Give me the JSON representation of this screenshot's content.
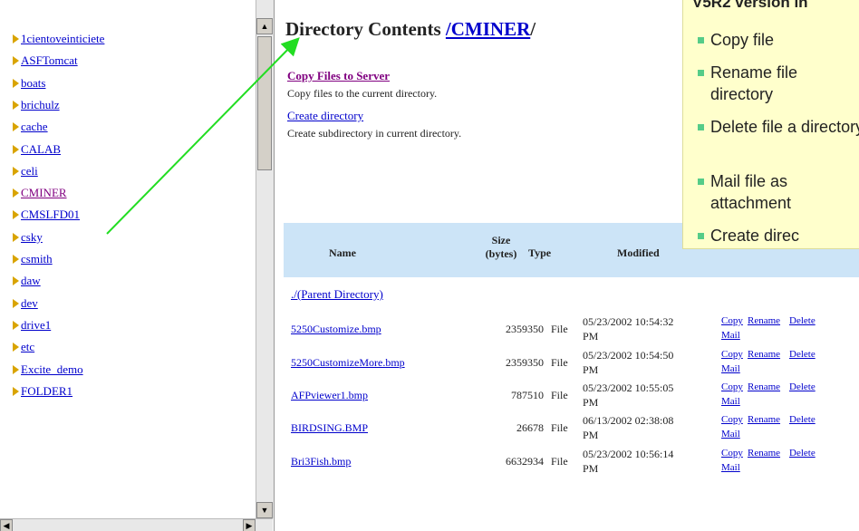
{
  "tree": {
    "items": [
      {
        "label": "1cientoveinticiete",
        "visited": false
      },
      {
        "label": "ASFTomcat",
        "visited": false
      },
      {
        "label": "boats",
        "visited": false
      },
      {
        "label": "brichulz",
        "visited": false
      },
      {
        "label": "cache",
        "visited": false
      },
      {
        "label": "CALAB",
        "visited": false
      },
      {
        "label": "celi",
        "visited": false
      },
      {
        "label": "CMINER",
        "visited": true
      },
      {
        "label": "CMSLFD01",
        "visited": false
      },
      {
        "label": "csky",
        "visited": false
      },
      {
        "label": "csmith",
        "visited": false
      },
      {
        "label": "daw",
        "visited": false
      },
      {
        "label": "dev",
        "visited": false
      },
      {
        "label": "drive1",
        "visited": false
      },
      {
        "label": "etc",
        "visited": false
      },
      {
        "label": "Excite_demo",
        "visited": false
      },
      {
        "label": "FOLDER1",
        "visited": false
      }
    ]
  },
  "main": {
    "title_prefix": "Directory Contents ",
    "title_link": "/CMINER",
    "title_suffix": "/",
    "copy_link": "Copy Files to Server",
    "copy_desc": "Copy files to the current directory.",
    "create_link": "Create directory",
    "create_desc": "Create subdirectory in current directory.",
    "headers": {
      "name": "Name",
      "size_line1": "Size",
      "size_line2": "(bytes)",
      "type": "Type",
      "modified": "Modified"
    },
    "parent_link": "./(Parent Directory)",
    "files": [
      {
        "name": "5250Customize.bmp",
        "size": "2359350",
        "type": "File",
        "date": "05/23/2002 10:54:32",
        "ampm": "PM"
      },
      {
        "name": "5250CustomizeMore.bmp",
        "size": "2359350",
        "type": "File",
        "date": "05/23/2002 10:54:50",
        "ampm": "PM"
      },
      {
        "name": "AFPviewer1.bmp",
        "size": "787510",
        "type": "File",
        "date": "05/23/2002 10:55:05",
        "ampm": "PM"
      },
      {
        "name": "BIRDSING.BMP",
        "size": "26678",
        "type": "File",
        "date": "06/13/2002 02:38:08",
        "ampm": "PM"
      },
      {
        "name": "Bri3Fish.bmp",
        "size": "6632934",
        "type": "File",
        "date": "05/23/2002 10:56:14",
        "ampm": "PM"
      }
    ],
    "actions": {
      "copy": "Copy",
      "rename": "Rename",
      "delete": "Delete",
      "mail": "Mail"
    }
  },
  "callout": {
    "title": "V5R2 version in",
    "items": [
      "Copy file",
      "Rename file directory",
      "Delete file a directory",
      "Mail file as attachment",
      "Create direc"
    ],
    "bullet_color": "#55cc88",
    "background": "#ffffcc"
  },
  "arrow_color": "#22dd22"
}
